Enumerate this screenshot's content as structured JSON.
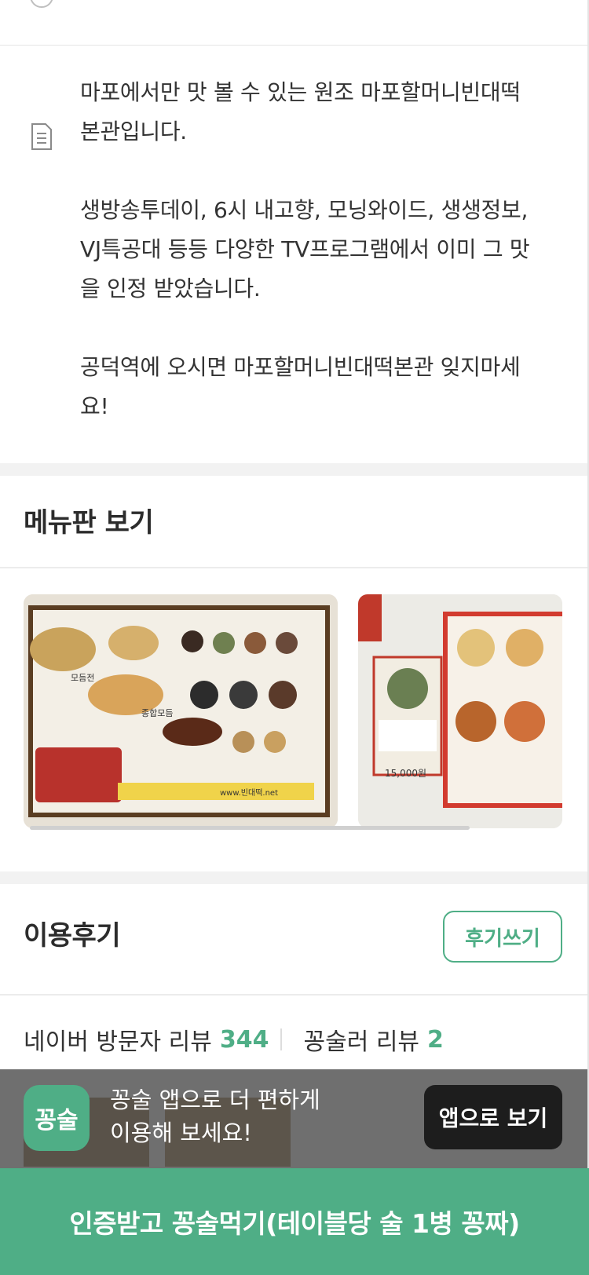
{
  "description": {
    "text": "마포에서만 맛 볼 수 있는 원조 마포할머니빈대떡\n본관입니다.\n\n생방송투데이, 6시 내고향, 모닝와이드, 생생정보,\nVJ특공대 등등 다양한 TV프로그램에서 이미 그 맛\n을 인정 받았습니다.\n\n공덕역에 오시면 마포할머니빈대떡본관 잊지마세\n요!",
    "icon": "document-icon"
  },
  "menu_section": {
    "title": "메뉴판 보기",
    "images": [
      {
        "alt": "menu-board-photo-1"
      },
      {
        "alt": "menu-board-photo-2"
      }
    ]
  },
  "review_section": {
    "title": "이용후기",
    "write_button": "후기쓰기",
    "naver_label": "네이버 방문자 리뷰",
    "naver_count": "344",
    "kkul_label": "꽁술러 리뷰",
    "kkul_count": "2"
  },
  "promo": {
    "logo_text": "꽁술",
    "message": "꽁술 앱으로 더 편하게\n이용해 보세요!",
    "button": "앱으로 보기"
  },
  "cta": {
    "label": "인증받고 꽁술먹기(테이블당 술 1병 꽁짜)"
  },
  "colors": {
    "accent": "#4fae86",
    "dark_button": "#1d1d1d",
    "gap": "#f2f2f2"
  }
}
